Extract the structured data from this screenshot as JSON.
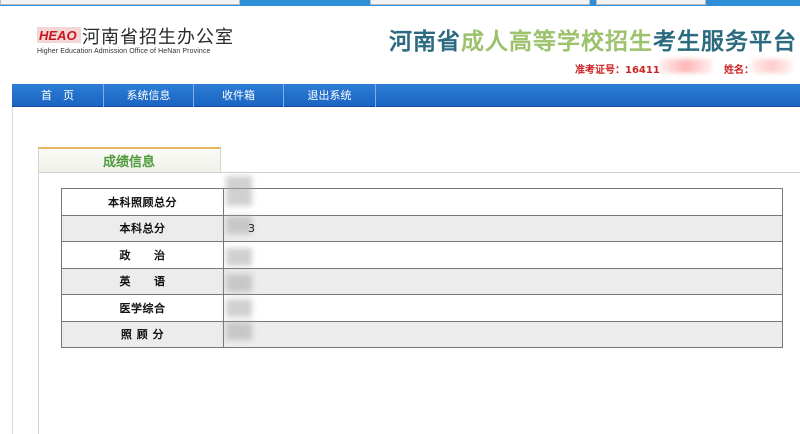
{
  "header": {
    "logo_text": "HEAO",
    "office_name": "河南省招生办公室",
    "office_name_en": "Higher Education Admission Office of HeNan Province",
    "platform_title_part1": "河南省",
    "platform_title_part2": "成人高等学校招生",
    "platform_title_part3": "考生服务平台",
    "examinee_id_label": "准考证号：16411",
    "examinee_name_label": "姓名："
  },
  "nav": {
    "items": [
      {
        "label": "首　页"
      },
      {
        "label": "系统信息"
      },
      {
        "label": "收件箱"
      },
      {
        "label": "退出系统"
      }
    ]
  },
  "panel": {
    "title": "成绩信息",
    "rows": [
      {
        "label": "本科照顾总分",
        "value": ""
      },
      {
        "label": "本科总分",
        "value": "3"
      },
      {
        "label": "政　　治",
        "value": ""
      },
      {
        "label": "英　　语",
        "value": ""
      },
      {
        "label": "医学综合",
        "value": ""
      },
      {
        "label": "照 顾 分",
        "value": ""
      }
    ]
  },
  "colors": {
    "nav_blue": "#1f6fcf",
    "title_teal": "#2b6a7f",
    "title_green": "#9cc26c",
    "examinee_red": "#cc2222",
    "panel_title_green": "#4e9a3c"
  }
}
